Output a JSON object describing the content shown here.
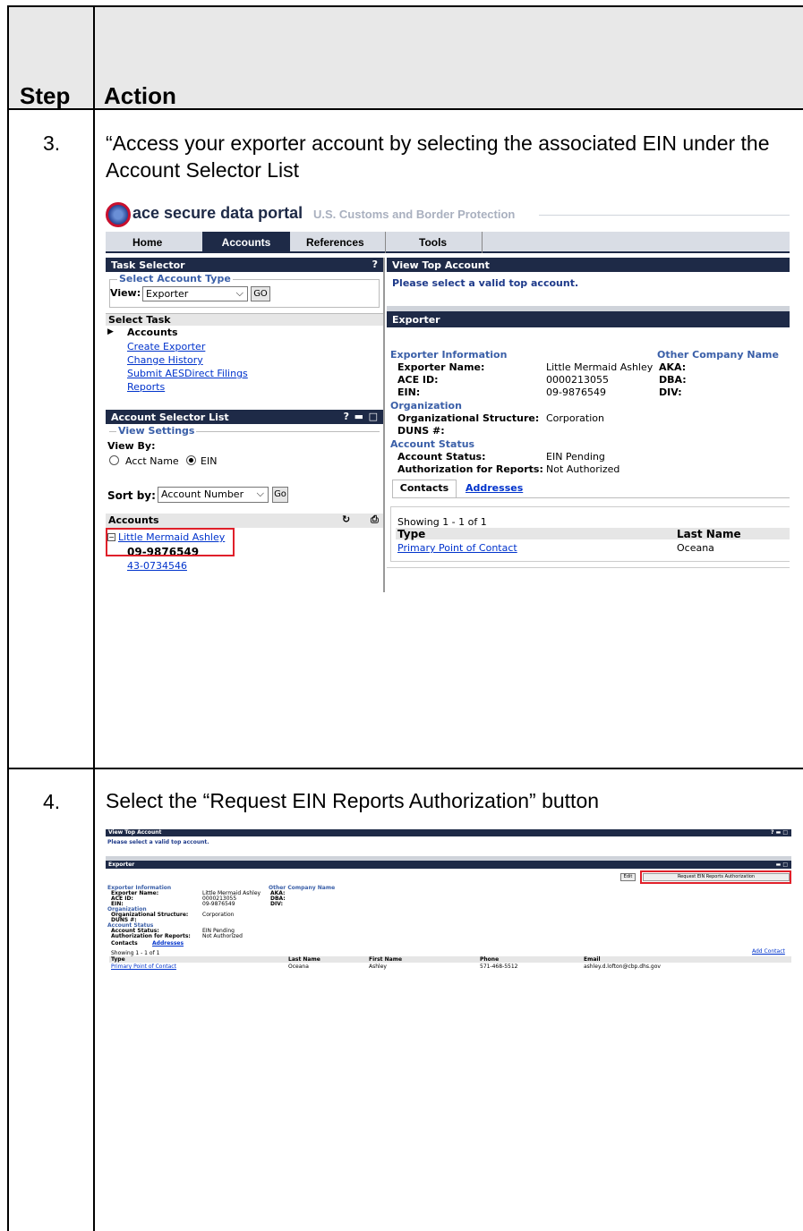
{
  "table": {
    "step_header": "Step",
    "action_header": "Action"
  },
  "step3": {
    "number": "3.",
    "instruction": "“Access your exporter account by selecting the associated EIN under the Account Selector List"
  },
  "step4": {
    "number": "4.",
    "instruction": "Select the “Request EIN Reports Authorization” button"
  },
  "portal": {
    "logo_text": "ace secure data portal",
    "agency": "U.S. Customs and Border Protection",
    "nav_tabs": [
      "Home",
      "Accounts",
      "References",
      "Tools"
    ],
    "active_tab": "Accounts",
    "task_selector": {
      "title": "Task Selector",
      "help": "?",
      "select_account_type": "Select Account Type",
      "view_label": "View:",
      "view_value": "Exporter",
      "go": "GO"
    },
    "select_task": {
      "title": "Select Task",
      "group": "Accounts",
      "links": [
        "Create Exporter",
        "Change History",
        "Submit AESDirect Filings",
        "Reports"
      ]
    },
    "account_selector": {
      "title": "Account Selector List",
      "help": "?",
      "view_settings": "View Settings",
      "view_by": "View By:",
      "acct_name": "Acct Name",
      "ein": "EIN",
      "sort_by": "Sort by:",
      "sort_value": "Account Number",
      "go": "Go",
      "accounts_header": "Accounts",
      "account_name": "Little Mermaid Ashley",
      "ein_selected": "09-9876549",
      "ein_other": "43-0734546"
    }
  },
  "view_top_account": {
    "title": "View Top Account",
    "message": "Please select a valid top account."
  },
  "exporter": {
    "title": "Exporter",
    "info_header": "Exporter Information",
    "other_company": "Other Company Name",
    "fields": [
      {
        "label": "Exporter Name:",
        "value": "Little Mermaid Ashley"
      },
      {
        "label": "ACE ID:",
        "value": "0000213055"
      },
      {
        "label": "EIN:",
        "value": "09-9876549"
      }
    ],
    "other_fields": [
      "AKA:",
      "DBA:",
      "DIV:"
    ],
    "org_header": "Organization",
    "org_struct_label": "Organizational Structure:",
    "org_struct_value": "Corporation",
    "duns_label": "DUNS #:",
    "status_header": "Account Status",
    "status_label": "Account Status:",
    "status_value": "EIN Pending",
    "auth_label": "Authorization for Reports:",
    "auth_value": "Not Authorized",
    "tabs": [
      "Contacts",
      "Addresses"
    ],
    "showing": "Showing 1 - 1 of 1",
    "col_type": "Type",
    "col_last": "Last Name",
    "col_first": "First Name",
    "col_phone": "Phone",
    "col_email": "Email",
    "row": {
      "type": "Primary Point of Contact",
      "last": "Oceana",
      "first": "Ashley",
      "phone": "571-468-5512",
      "email": "ashley.d.lofton@cbp.dhs.gov"
    },
    "edit": "Edit",
    "request_btn": "Request EIN Reports Authorization",
    "add_contact": "Add Contact"
  }
}
